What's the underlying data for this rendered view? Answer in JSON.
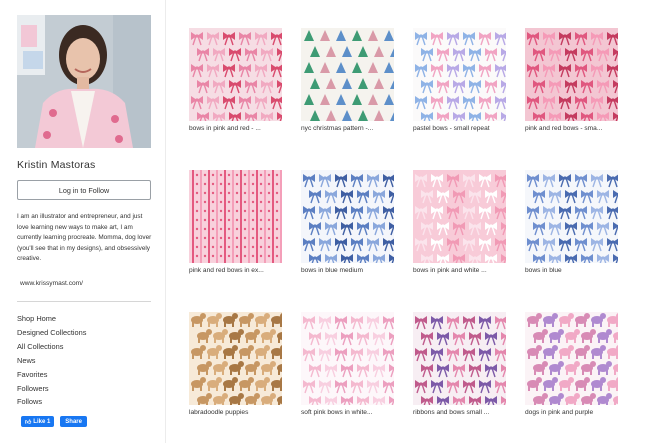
{
  "profile": {
    "name": "Kristin Mastoras",
    "follow_label": "Log in to Follow",
    "bio": "I am an illustrator and entrepreneur, and just love learning new ways to make art, I am currently learning procreate. Momma, dog lover (you'll see that in my designs), and obsessively creative.",
    "website": "www.krissymast.com/"
  },
  "nav": {
    "items": [
      "Shop Home",
      "Designed Collections",
      "All Collections",
      "News",
      "Favorites",
      "Followers",
      "Follows"
    ]
  },
  "social": {
    "like_label": "Like 1",
    "share_label": "Share"
  },
  "designs": [
    {
      "caption": "bows in pink and red - ...",
      "bg": "#f6dde4",
      "colors": [
        "#e985a6",
        "#f1a9c1",
        "#d94b6e"
      ],
      "motif": "bow"
    },
    {
      "caption": "nyc christmas pattern -...",
      "bg": "#f5f3ee",
      "colors": [
        "#3e9b74",
        "#d99aa8",
        "#5d8fc9"
      ],
      "motif": "tree"
    },
    {
      "caption": "pastel bows - small repeat",
      "bg": "#fbfafa",
      "colors": [
        "#8fb3e6",
        "#f1a4c3",
        "#b8a9e6"
      ],
      "motif": "bow"
    },
    {
      "caption": "pink and red bows - sma...",
      "bg": "#f3c6d2",
      "colors": [
        "#e0577f",
        "#f59ab7",
        "#c43b5f"
      ],
      "motif": "bow"
    },
    {
      "caption": "pink and red bows in ex...",
      "bg": "#f8d1dc",
      "colors": [
        "#e45a80",
        "#f49fb9"
      ],
      "motif": "stripe"
    },
    {
      "caption": "bows in blue medium",
      "bg": "#f4f6fb",
      "colors": [
        "#5c7fc2",
        "#8aa7dc",
        "#3f5fa3"
      ],
      "motif": "bow"
    },
    {
      "caption": "bows in pink and white ...",
      "bg": "#f8cbd8",
      "colors": [
        "#fbe4ec",
        "#ffffff",
        "#f19ab5"
      ],
      "motif": "bow"
    },
    {
      "caption": "bows in blue",
      "bg": "#f5f7fb",
      "colors": [
        "#6f8fcf",
        "#9db5e4",
        "#4a6bb0"
      ],
      "motif": "bow"
    },
    {
      "caption": "labradoodle puppies",
      "bg": "#f7ead8",
      "colors": [
        "#c79763",
        "#d9ad7c",
        "#a87845"
      ],
      "motif": "dog"
    },
    {
      "caption": "soft pink bows in white...",
      "bg": "#fdf7fa",
      "colors": [
        "#f4b9cf",
        "#f8cfe0",
        "#ec9fbf"
      ],
      "motif": "bow"
    },
    {
      "caption": "ribbons and bows small ...",
      "bg": "#f7eef3",
      "colors": [
        "#c05b8c",
        "#7d5aa8",
        "#e487ad"
      ],
      "motif": "bow"
    },
    {
      "caption": "dogs in pink and purple",
      "bg": "#fbf3f6",
      "colors": [
        "#d88bb5",
        "#b08ad0",
        "#f1a9c6"
      ],
      "motif": "dog"
    }
  ]
}
